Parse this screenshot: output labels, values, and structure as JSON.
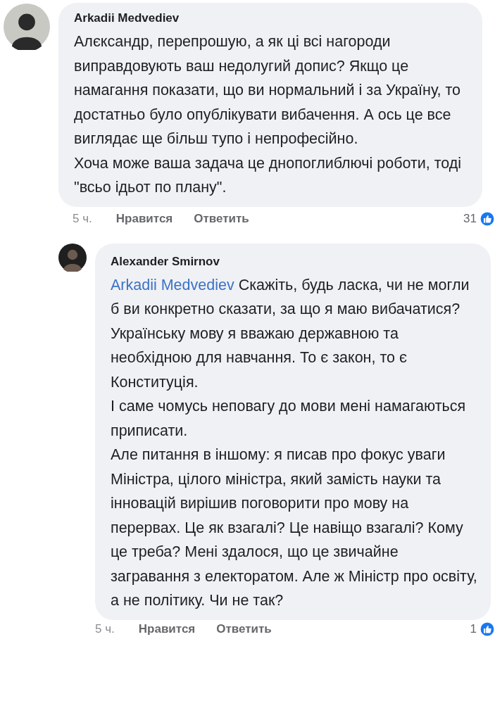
{
  "comments": [
    {
      "kind": "comment",
      "author": "Arkadii Medvediev",
      "paragraphs": [
        "Алєксандр, перепрошую, а як ці всі нагороди виправдовують ваш недолугий допис? Якщо це намагання показати, що ви нормальний і за Україну, то достатньо було опублікувати вибачення. А ось це все виглядає ще більш тупо і непрофесійно.",
        "Хоча може ваша задача це днопоглиблючі роботи, тоді \"всьо ідьот по плану\"."
      ],
      "time": "5 ч.",
      "actions": [
        "Нравится",
        "Ответить"
      ],
      "likes": "31"
    },
    {
      "kind": "reply",
      "author": "Alexander Smirnov",
      "mention": "Arkadii Medvediev",
      "paragraphs": [
        "Скажіть, будь ласка, чи не могли б ви конкретно сказати, за що я маю вибачатися?",
        "Українську мову я вважаю державною та необхідною для навчання. То є закон, то є Конституція.",
        "І саме чомусь неповагу до мови мені намагаються приписати.",
        "Але питання в іншому: я писав про фокус уваги Міністра, цілого міністра, який замість науки та інновацій вирішив поговорити про мову на перервах. Це як взагалі? Це навіщо взагалі? Кому це треба? Мені здалося, що це звичайне загравання з електоратом. Але ж Міністр про освіту, а не політику. Чи не так?"
      ],
      "time": "5 ч.",
      "actions": [
        "Нравится",
        "Ответить"
      ],
      "likes": "1"
    }
  ]
}
